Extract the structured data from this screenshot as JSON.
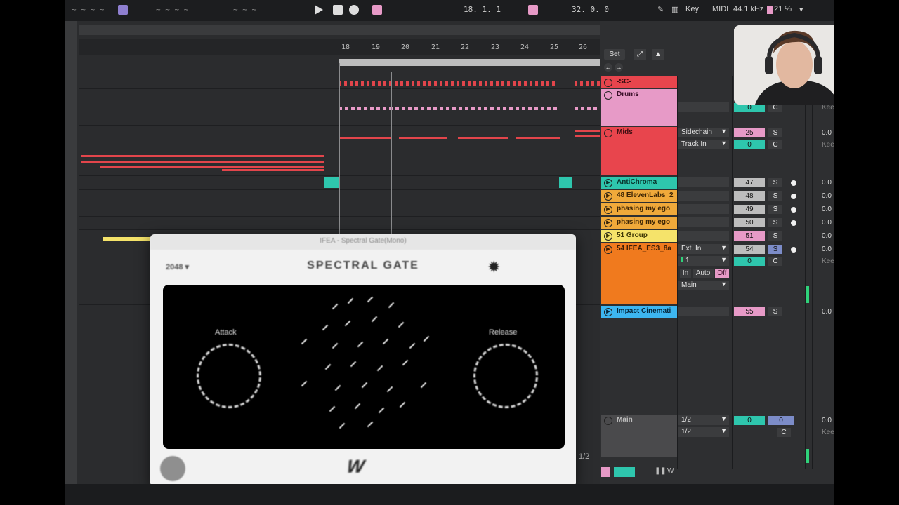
{
  "transport": {
    "position": "18. 1. 1",
    "loop_length": "32. 0. 0",
    "key_label": "Key",
    "midi_label": "MIDI",
    "sample_rate": "44.1 kHz",
    "cpu": "21 %"
  },
  "ruler": {
    "bars": [
      "18",
      "19",
      "20",
      "21",
      "22",
      "23",
      "24",
      "25",
      "26"
    ]
  },
  "mixer": {
    "set_label": "Set",
    "tracks": [
      {
        "name": "-SC-",
        "color": "#e8454d"
      },
      {
        "name": "Drums",
        "color": "#e79ac7"
      },
      {
        "name": "Mids",
        "color": "#e8454d"
      },
      {
        "name": "AntiChroma",
        "color": "#2ec6ad"
      },
      {
        "name": "48 ElevenLabs_2",
        "color": "#f0a93a"
      },
      {
        "name": "phasing my ego",
        "color": "#f0a93a"
      },
      {
        "name": "phasing my ego",
        "color": "#f0a93a"
      },
      {
        "name": "51 Group",
        "color": "#f5e36a"
      },
      {
        "name": "54 IFEA_ES3_8a",
        "color": "#f07a1e"
      },
      {
        "name": "Impact Cinemati",
        "color": "#3db6f0"
      }
    ],
    "io": {
      "sidechain": "Sidechain",
      "track_in": "Track In",
      "ext_in": "Ext. In",
      "ch1": "1",
      "in_label": "In",
      "auto_label": "Auto",
      "off_label": "Off",
      "main": "Main",
      "main_a": "1/2",
      "main_b": "1/2"
    },
    "values": {
      "drums_pan": "0",
      "mids_send": "25",
      "mids_pan": "0",
      "anti": "47",
      "eleven": "48",
      "phase1": "49",
      "phase2": "50",
      "group51": "51",
      "ifea": "54",
      "ifea_pan": "0",
      "impact": "55",
      "main_pan": "0",
      "main_vol": "0"
    },
    "buttons": {
      "solo": "S",
      "center": "C"
    },
    "right": {
      "zero": "0.0",
      "keep": "Keep"
    },
    "main_track": "Main",
    "bottom_right": "1/2"
  },
  "plugin": {
    "title": "IFEA - Spectral Gate(Mono)",
    "preset": "2048",
    "name": "SPECTRAL GATE",
    "attack_label": "Attack",
    "release_label": "Release",
    "logo": "W"
  },
  "colors": {
    "accent_pink": "#e79ac7",
    "accent_red": "#e2454b",
    "accent_cyan": "#2ec6ad"
  }
}
